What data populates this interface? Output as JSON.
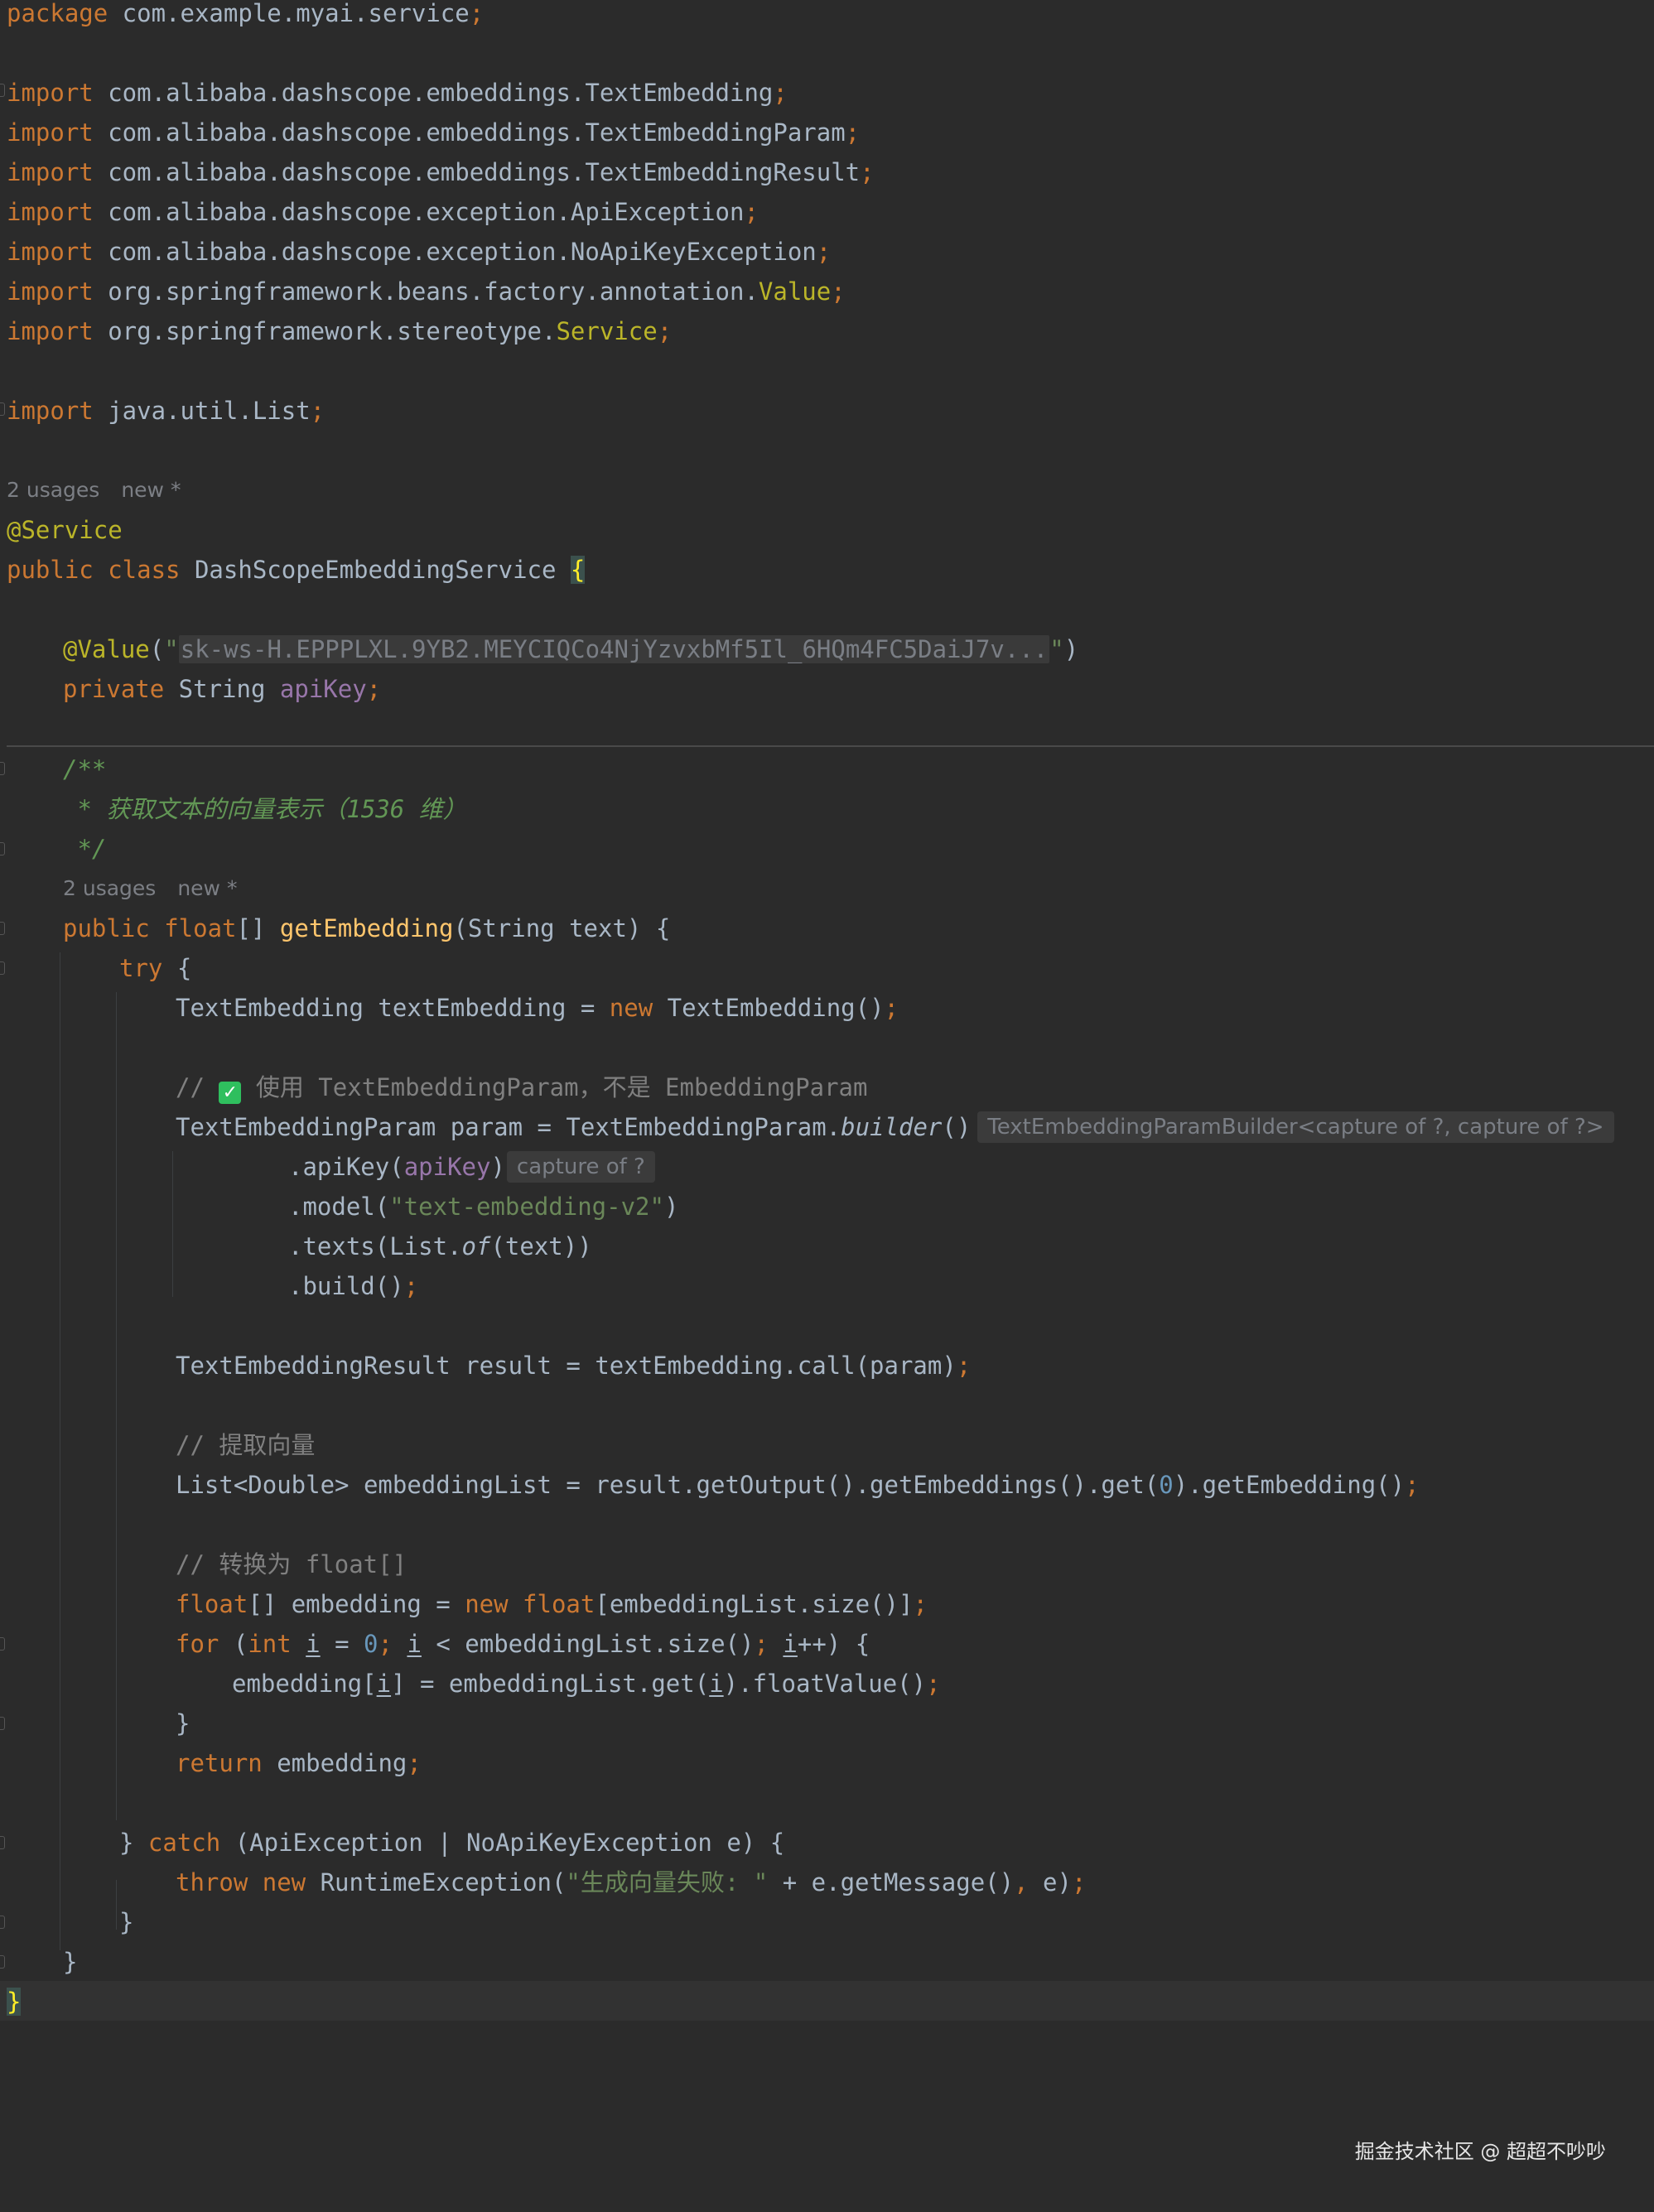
{
  "usages_label": "2 usages",
  "new_label": "new *",
  "folded_api_key": "sk-ws-H.EPPPLXL.9YB2.MEYCIQCo4NjYzvxbMf5Il_6HQm4FC5DaiJ7v...",
  "hints": {
    "builder_type": "TextEmbeddingParamBuilder<capture of ?, capture of ?>",
    "apikey_type": "capture of ?"
  },
  "comments": {
    "doc_line": " * 获取文本的向量表示（1536 维）",
    "param_note": " 使用 TextEmbeddingParam，不是 EmbeddingParam",
    "extract": "// 提取向量",
    "convert": "// 转换为 float[]"
  },
  "strings": {
    "model": "\"text-embedding-v2\"",
    "error": "\"生成向量失败: \""
  },
  "watermark": "掘金技术社区 @ 超超不吵吵",
  "colors": {
    "background": "#2b2b2b",
    "keyword": "#cc7832",
    "annotation": "#bbb529",
    "string": "#6a8759",
    "number": "#6897bb",
    "field": "#9876aa",
    "method_decl": "#ffc66d",
    "comment": "#808080",
    "doc_comment": "#629755",
    "default_text": "#a9b7c6",
    "check_badge": "#2fbf5e"
  },
  "icons": [
    "check-mark-icon"
  ]
}
